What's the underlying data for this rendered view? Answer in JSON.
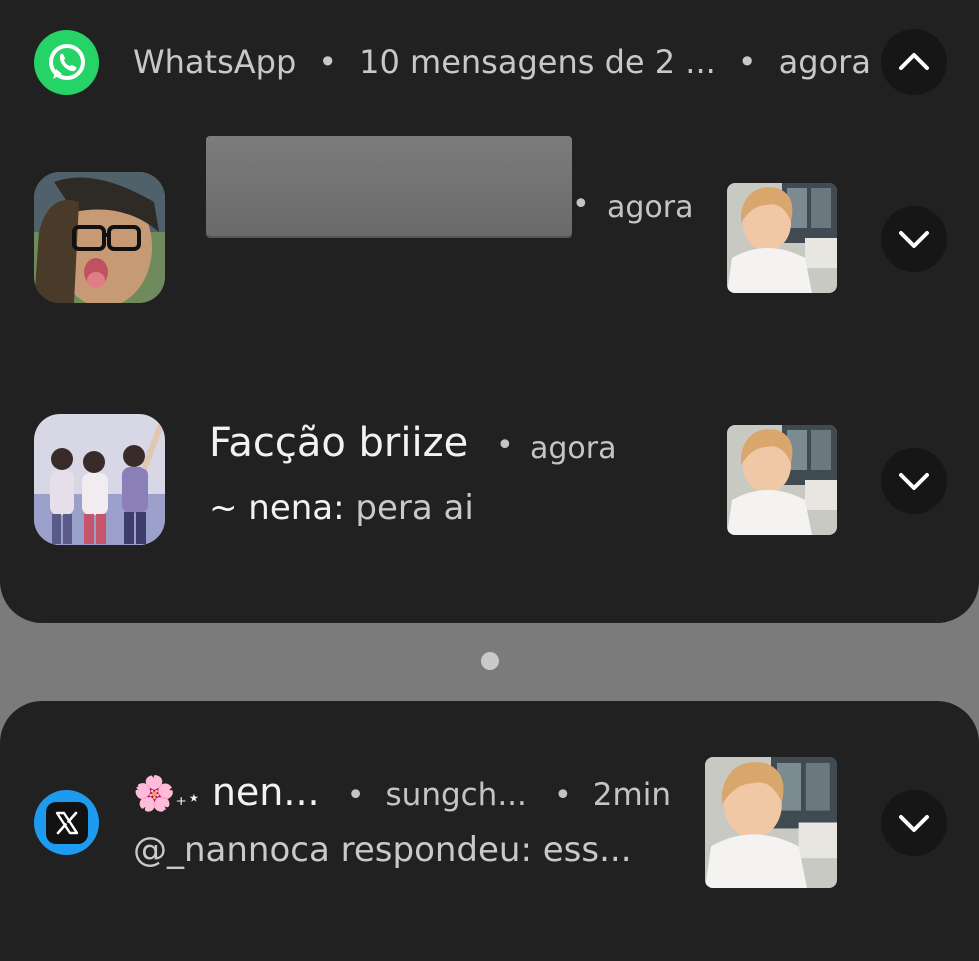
{
  "whatsapp": {
    "app_name": "WhatsApp",
    "summary": "10 mensagens de 2 ...",
    "time": "agora",
    "accent": "#25d366",
    "collapse_icon": "chevron-up-icon",
    "notifications": [
      {
        "title": "",
        "time": "agora",
        "expand_icon": "chevron-down-icon"
      },
      {
        "title": "Facção briize",
        "time": "agora",
        "sender": "~ nena:",
        "message": "pera ai",
        "expand_icon": "chevron-down-icon"
      }
    ]
  },
  "x": {
    "app_icon": "x-logo-icon",
    "accent": "#1d9bf0",
    "title_emoji": "🌸",
    "title_sparkle": "₊⋆",
    "title": "nen...",
    "account": "sungch...",
    "time": "2min",
    "message": "@_nannoca respondeu: ess...",
    "expand_icon": "chevron-down-icon"
  }
}
